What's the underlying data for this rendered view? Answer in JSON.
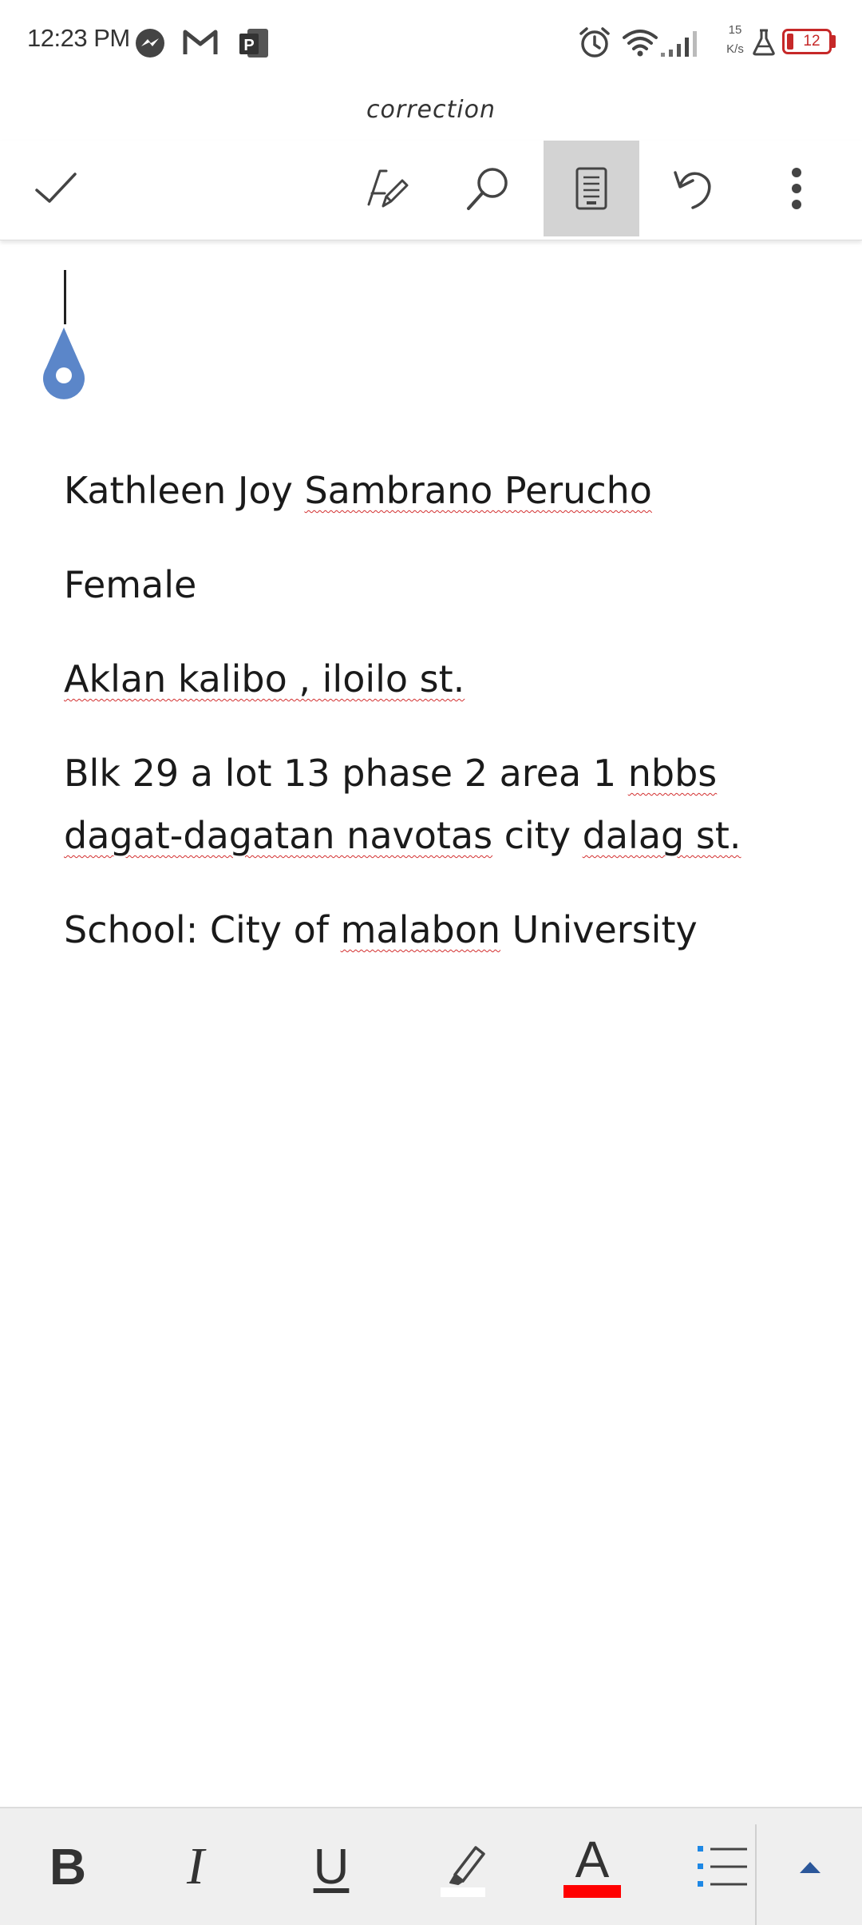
{
  "status_bar": {
    "time": "12:23 PM",
    "net_speed_value": "15",
    "net_speed_unit": "K/s",
    "battery_level": "12",
    "icons": [
      "messenger-icon",
      "gmail-icon",
      "publisher-icon",
      "alarm-icon",
      "wifi-icon",
      "signal-icon",
      "flask-icon",
      "battery-icon"
    ]
  },
  "document": {
    "title": "correction",
    "paragraphs": [
      [
        "Kathleen Joy ",
        "Sambrano Perucho"
      ],
      [
        "Female"
      ],
      [
        "Aklan kalibo , iloilo st."
      ],
      [
        "Blk 29 a lot 13 phase 2 area 1 ",
        "nbbs",
        " ",
        "dagat-dagatan navotas",
        " city ",
        "dalag st."
      ],
      [
        "School: City of ",
        "malabon",
        " University"
      ]
    ]
  },
  "toolbar": {
    "icons": [
      "checkmark-icon",
      "draw-pen-icon",
      "search-icon",
      "mobile-view-icon",
      "undo-icon",
      "more-options-icon"
    ],
    "active": "mobile-view-icon"
  },
  "format_bar": {
    "bold": "B",
    "italic": "I",
    "underline": "U",
    "font_color_letter": "A",
    "highlight_color": "#ffffff",
    "font_color": "#ff0000",
    "accent": "#2b579a",
    "list_bullet_color": "#1e88e5"
  }
}
